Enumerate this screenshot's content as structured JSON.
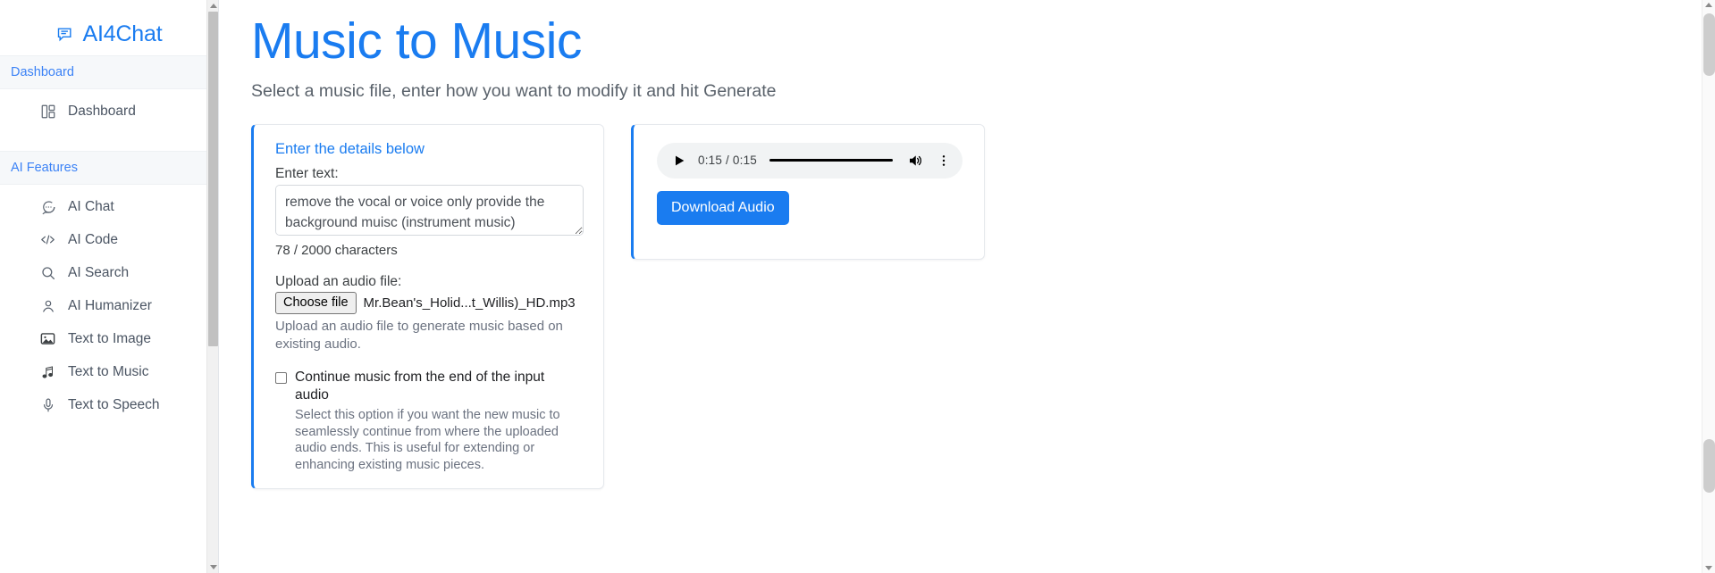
{
  "brand": {
    "name": "AI4Chat",
    "icon": "chat-bubble-icon"
  },
  "sidebar": {
    "sections": [
      {
        "title": "Dashboard",
        "items": [
          {
            "label": "Dashboard",
            "icon": "dashboard-layout-icon"
          }
        ]
      },
      {
        "title": "AI Features",
        "items": [
          {
            "label": "AI Chat",
            "icon": "chat-dots-icon"
          },
          {
            "label": "AI Code",
            "icon": "code-brackets-icon"
          },
          {
            "label": "AI Search",
            "icon": "search-icon"
          },
          {
            "label": "AI Humanizer",
            "icon": "person-icon"
          },
          {
            "label": "Text to Image",
            "icon": "image-icon"
          },
          {
            "label": "Text to Music",
            "icon": "music-note-icon"
          },
          {
            "label": "Text to Speech",
            "icon": "microphone-icon"
          }
        ]
      }
    ]
  },
  "header": {
    "title": "Music to Music",
    "subtitle": "Select a music file, enter how you want to modify it and hit Generate"
  },
  "form": {
    "heading": "Enter the details below",
    "text_label": "Enter text:",
    "text_value": "remove the vocal or voice only provide the background muisc (instrument music)",
    "text_placeholder": "",
    "char_count": "78 / 2000 characters",
    "upload_label": "Upload an audio file:",
    "choose_file_button": "Choose file",
    "file_name": "Mr.Bean's_Holid...t_Willis)_HD.mp3",
    "upload_help": "Upload an audio file to generate music based on existing audio.",
    "continue_checkbox_label": "Continue music from the end of the input audio",
    "continue_checkbox_desc": "Select this option if you want the new music to seamlessly continue from where the uploaded audio ends. This is useful for extending or enhancing existing music pieces.",
    "continue_checked": false
  },
  "result": {
    "audio": {
      "current_time": "0:15",
      "duration": "0:15",
      "time_display": "0:15 / 0:15",
      "play_icon": "play-icon",
      "volume_icon": "volume-icon",
      "menu_icon": "more-vertical-icon"
    },
    "download_button": "Download Audio"
  },
  "colors": {
    "accent": "#1a7cf0",
    "text": "#3c4043",
    "muted": "#6b7280",
    "panel": "#f1f3f4"
  }
}
